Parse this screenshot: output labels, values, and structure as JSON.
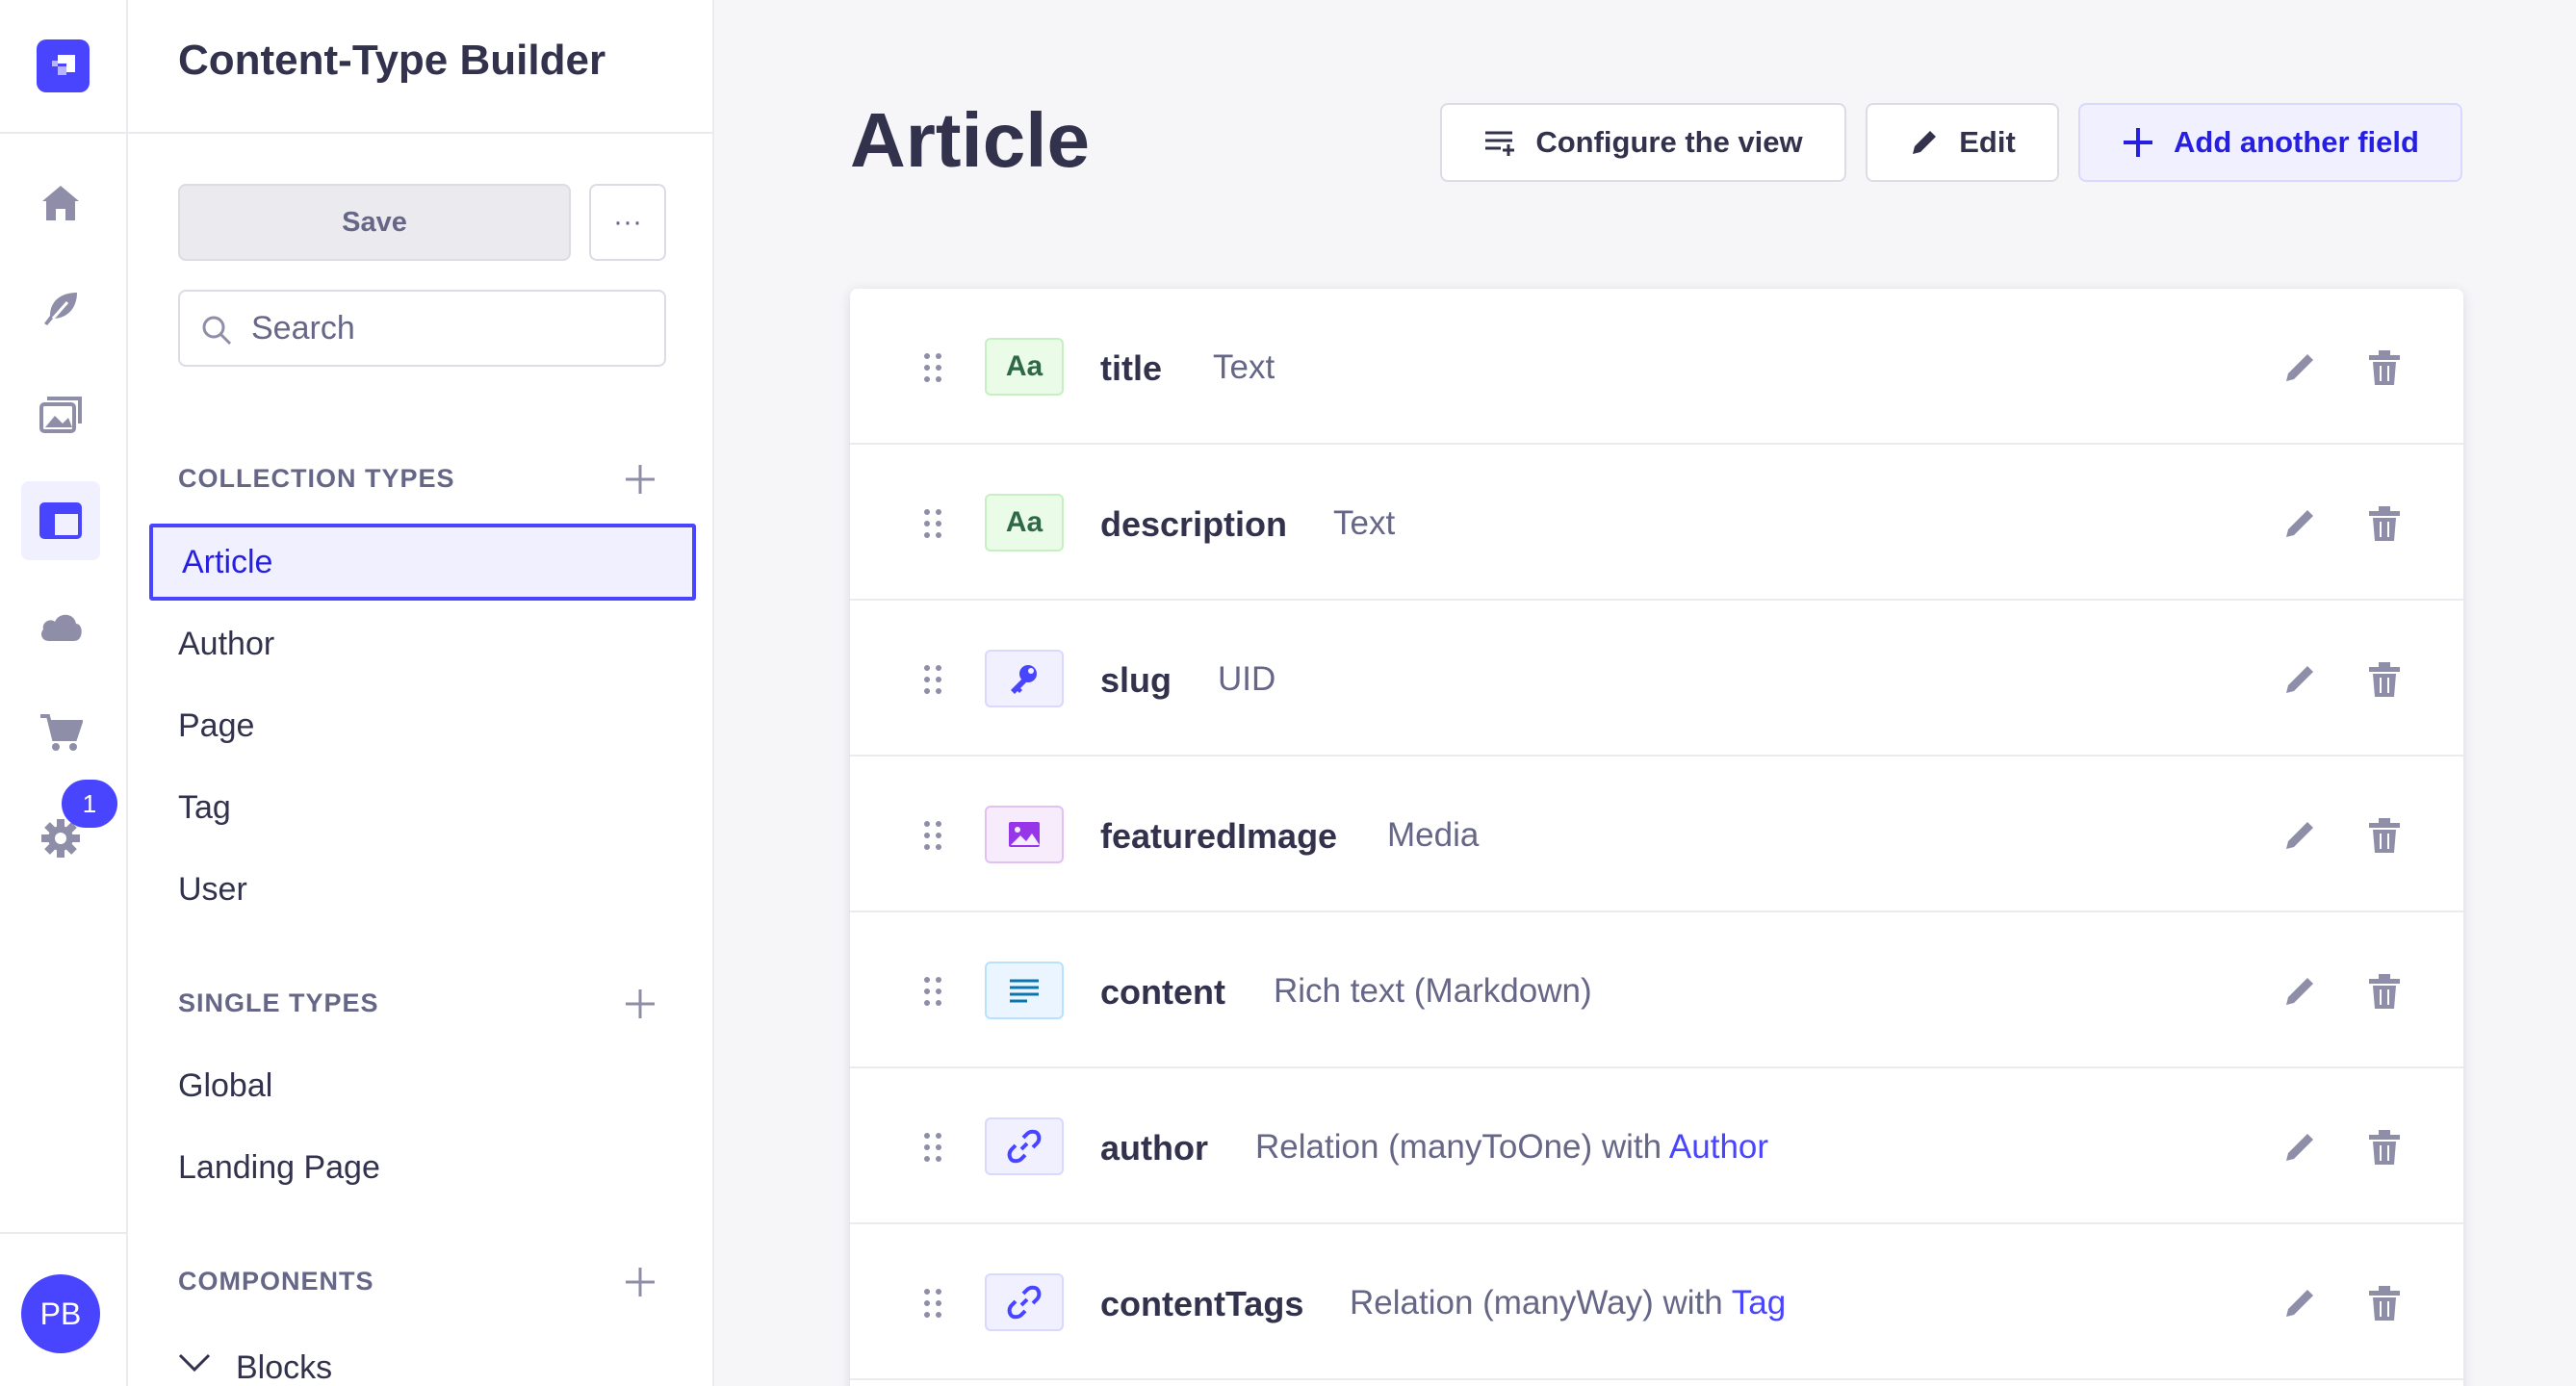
{
  "rail": {
    "items": [
      "home-icon",
      "feather-icon",
      "media-icon",
      "layout-icon",
      "cloud-icon",
      "cart-icon",
      "gear-icon"
    ],
    "badge": "1",
    "avatar_initials": "PB"
  },
  "subnav": {
    "title": "Content-Type Builder",
    "save_label": "Save",
    "more_label": "···",
    "search_placeholder": "Search",
    "collection_types_label": "COLLECTION TYPES",
    "collection_types": [
      "Article",
      "Author",
      "Page",
      "Tag",
      "User"
    ],
    "single_types_label": "SINGLE TYPES",
    "single_types": [
      "Global",
      "Landing Page"
    ],
    "components_label": "COMPONENTS",
    "components": [
      "Blocks"
    ]
  },
  "main": {
    "title": "Article",
    "configure_label": "Configure the view",
    "edit_label": "Edit",
    "add_field_label": "Add another field",
    "fields": [
      {
        "name": "title",
        "type_icon": "text-icon",
        "description": "Text",
        "link": ""
      },
      {
        "name": "description",
        "type_icon": "text-icon",
        "description": "Text",
        "link": ""
      },
      {
        "name": "slug",
        "type_icon": "key-icon",
        "description": "UID",
        "link": ""
      },
      {
        "name": "featuredImage",
        "type_icon": "image-icon",
        "description": "Media",
        "link": ""
      },
      {
        "name": "content",
        "type_icon": "paragraph-icon",
        "description": "Rich text (Markdown)",
        "link": ""
      },
      {
        "name": "author",
        "type_icon": "link-icon",
        "description": "Relation (manyToOne) with",
        "link": "Author"
      },
      {
        "name": "contentTags",
        "type_icon": "link-icon",
        "description": "Relation (manyWay) with",
        "link": "Tag"
      }
    ],
    "text_icon_glyph": "Aa"
  },
  "colors": {
    "primary": "#4945ff",
    "primary_light": "#f0f0ff",
    "text_dark": "#32324d",
    "text_muted": "#666687",
    "background": "#f6f6f9"
  }
}
